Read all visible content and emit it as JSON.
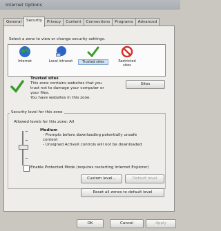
{
  "window": {
    "title": "Internet Options"
  },
  "tabs": [
    {
      "label": "General",
      "active": false
    },
    {
      "label": "Security",
      "active": true
    },
    {
      "label": "Privacy",
      "active": false
    },
    {
      "label": "Content",
      "active": false
    },
    {
      "label": "Connections",
      "active": false
    },
    {
      "label": "Programs",
      "active": false
    },
    {
      "label": "Advanced",
      "active": false
    }
  ],
  "security": {
    "select_zone_text": "Select a zone to view or change security settings.",
    "zones": [
      {
        "label": "Internet",
        "icon": "globe-icon",
        "selected": false
      },
      {
        "label": "Local intranet",
        "icon": "network-icon",
        "selected": false
      },
      {
        "label": "Trusted sites",
        "icon": "checkmark-icon",
        "selected": true
      },
      {
        "label": "Restricted",
        "label2": "sites",
        "icon": "restricted-icon",
        "selected": false
      }
    ],
    "zone_info": {
      "title": "Trusted sites",
      "desc": [
        "This zone contains websites that you",
        "trust not to damage your computer or",
        "your files."
      ],
      "status": "You have websites in this zone.",
      "sites_button": "Sites"
    },
    "level_group": {
      "title": "Security level for this zone",
      "allowed": "Allowed levels for this zone: All",
      "level_name": "Medium",
      "bullets": [
        "- Prompts before downloading potentially unsafe",
        "  content",
        "- Unsigned ActiveX controls will not be downloaded"
      ],
      "slider_level_fraction": 0.5
    },
    "protected_mode": {
      "label": "Enable Protected Mode (requires restarting Internet Explorer)",
      "checked": false
    },
    "custom_level_button": "Custom level...",
    "default_level_button": "Default level",
    "reset_all_button": "Reset all zones to default level"
  },
  "footer": {
    "ok": "OK",
    "cancel": "Cancel",
    "apply": "Apply"
  },
  "colors": {
    "accent_check": "#3a9b2a",
    "restricted": "#d5312a",
    "globe": "#2a6fd0"
  }
}
